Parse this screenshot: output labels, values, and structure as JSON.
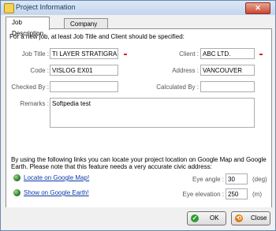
{
  "window": {
    "title": "Project Information"
  },
  "tabs": [
    {
      "label": "Job Description"
    },
    {
      "label": "Company Information"
    }
  ],
  "form": {
    "intro": "For a new job, at least Job Title and Client should be specified:",
    "job_title": {
      "label": "Job Title :",
      "value": "TI LAYER STRATIGRAPHY"
    },
    "client": {
      "label": "Client :",
      "value": "ABC LTD."
    },
    "code": {
      "label": "Code :",
      "value": "VISLOG EX01"
    },
    "address": {
      "label": "Address :",
      "value": "VANCOUVER"
    },
    "checked_by": {
      "label": "Checked By :",
      "value": ""
    },
    "calculated_by": {
      "label": "Calculated By :",
      "value": ""
    },
    "remarks": {
      "label": "Remarks :",
      "value": "Softpedia test"
    }
  },
  "location": {
    "description": "By using the following links you can locate your project location on Google Map and Google Earth. Please note that this feature needs a very accurate civic address:",
    "map_link": "Locate on Google Map!",
    "earth_link": "Show on Google Earth!",
    "eye_angle": {
      "label": "Eye angle :",
      "value": "30",
      "unit": "(deg)"
    },
    "eye_elevation": {
      "label": "Eye elevation :",
      "value": "250",
      "unit": "(m)"
    }
  },
  "buttons": {
    "ok": "OK",
    "close": "Close"
  },
  "colors": {
    "accent": "#0a3aa8",
    "required": "#e02020",
    "ok_icon": "#2e9e2e",
    "close_icon": "#e07a10"
  }
}
